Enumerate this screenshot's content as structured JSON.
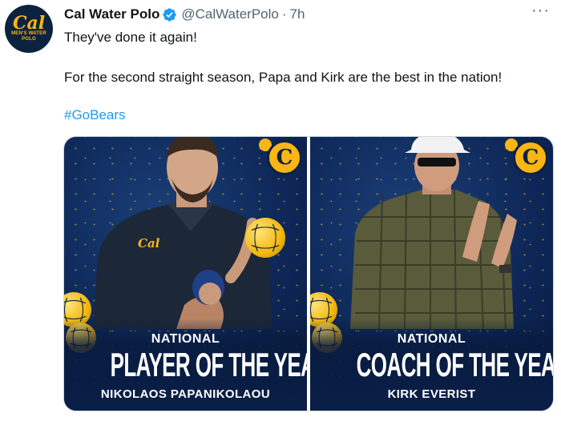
{
  "tweet": {
    "avatar": {
      "logo": "Cal",
      "sub": "MEN'S WATER POLO"
    },
    "author_name": "Cal Water Polo",
    "handle": "@CalWaterPolo",
    "separator": "·",
    "time": "7h",
    "more": "···",
    "lines": [
      "They've done it again!",
      "For the second straight season, Papa and Kirk are the best in the nation!"
    ],
    "hashtag": "#GoBears",
    "icons": {
      "verified": "verified-badge-icon",
      "more": "more-options-icon"
    },
    "colors": {
      "link": "#1d9bf0",
      "verified": "#1d9bf0",
      "navy": "#0c2340",
      "gold": "#fdb515"
    }
  },
  "media": [
    {
      "small_text": "NATIONAL",
      "main_text": "PLAYER OF THE YEAR",
      "name_text": "NIKOLAOS PAPANIKOLAOU",
      "badge": "C",
      "jersey_logo": "Cal"
    },
    {
      "small_text": "NATIONAL",
      "main_text": "COACH OF THE YEAR",
      "name_text": "KIRK EVERIST",
      "badge": "C"
    }
  ]
}
